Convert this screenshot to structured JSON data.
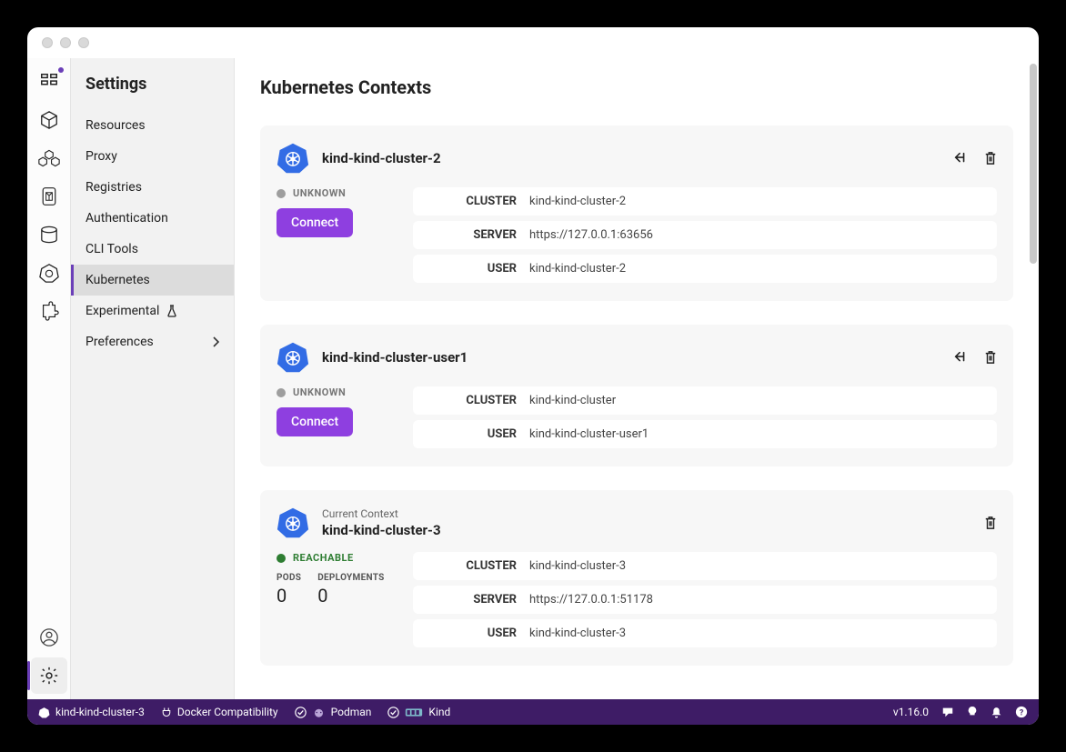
{
  "settings": {
    "title": "Settings",
    "items": [
      {
        "label": "Resources"
      },
      {
        "label": "Proxy"
      },
      {
        "label": "Registries"
      },
      {
        "label": "Authentication"
      },
      {
        "label": "CLI Tools"
      },
      {
        "label": "Kubernetes",
        "active": true
      },
      {
        "label": "Experimental",
        "icon": "flask"
      },
      {
        "label": "Preferences",
        "caret": true
      }
    ]
  },
  "main": {
    "title": "Kubernetes Contexts",
    "contexts": [
      {
        "name": "kind-kind-cluster-2",
        "current": false,
        "status": "UNKNOWN",
        "status_kind": "unknown",
        "connect_label": "Connect",
        "show_use": true,
        "info": [
          {
            "k": "CLUSTER",
            "v": "kind-kind-cluster-2"
          },
          {
            "k": "SERVER",
            "v": "https://127.0.0.1:63656"
          },
          {
            "k": "USER",
            "v": "kind-kind-cluster-2"
          }
        ]
      },
      {
        "name": "kind-kind-cluster-user1",
        "current": false,
        "status": "UNKNOWN",
        "status_kind": "unknown",
        "connect_label": "Connect",
        "show_use": true,
        "info": [
          {
            "k": "CLUSTER",
            "v": "kind-kind-cluster"
          },
          {
            "k": "USER",
            "v": "kind-kind-cluster-user1"
          }
        ]
      },
      {
        "name": "kind-kind-cluster-3",
        "current": true,
        "current_label": "Current Context",
        "status": "REACHABLE",
        "status_kind": "reachable",
        "show_use": false,
        "stats": {
          "pods_label": "PODS",
          "pods": "0",
          "deps_label": "DEPLOYMENTS",
          "deps": "0"
        },
        "info": [
          {
            "k": "CLUSTER",
            "v": "kind-kind-cluster-3"
          },
          {
            "k": "SERVER",
            "v": "https://127.0.0.1:51178"
          },
          {
            "k": "USER",
            "v": "kind-kind-cluster-3"
          }
        ]
      }
    ]
  },
  "statusbar": {
    "context": "kind-kind-cluster-3",
    "docker": "Docker Compatibility",
    "podman": "Podman",
    "kind": "Kind",
    "version": "v1.16.0"
  }
}
